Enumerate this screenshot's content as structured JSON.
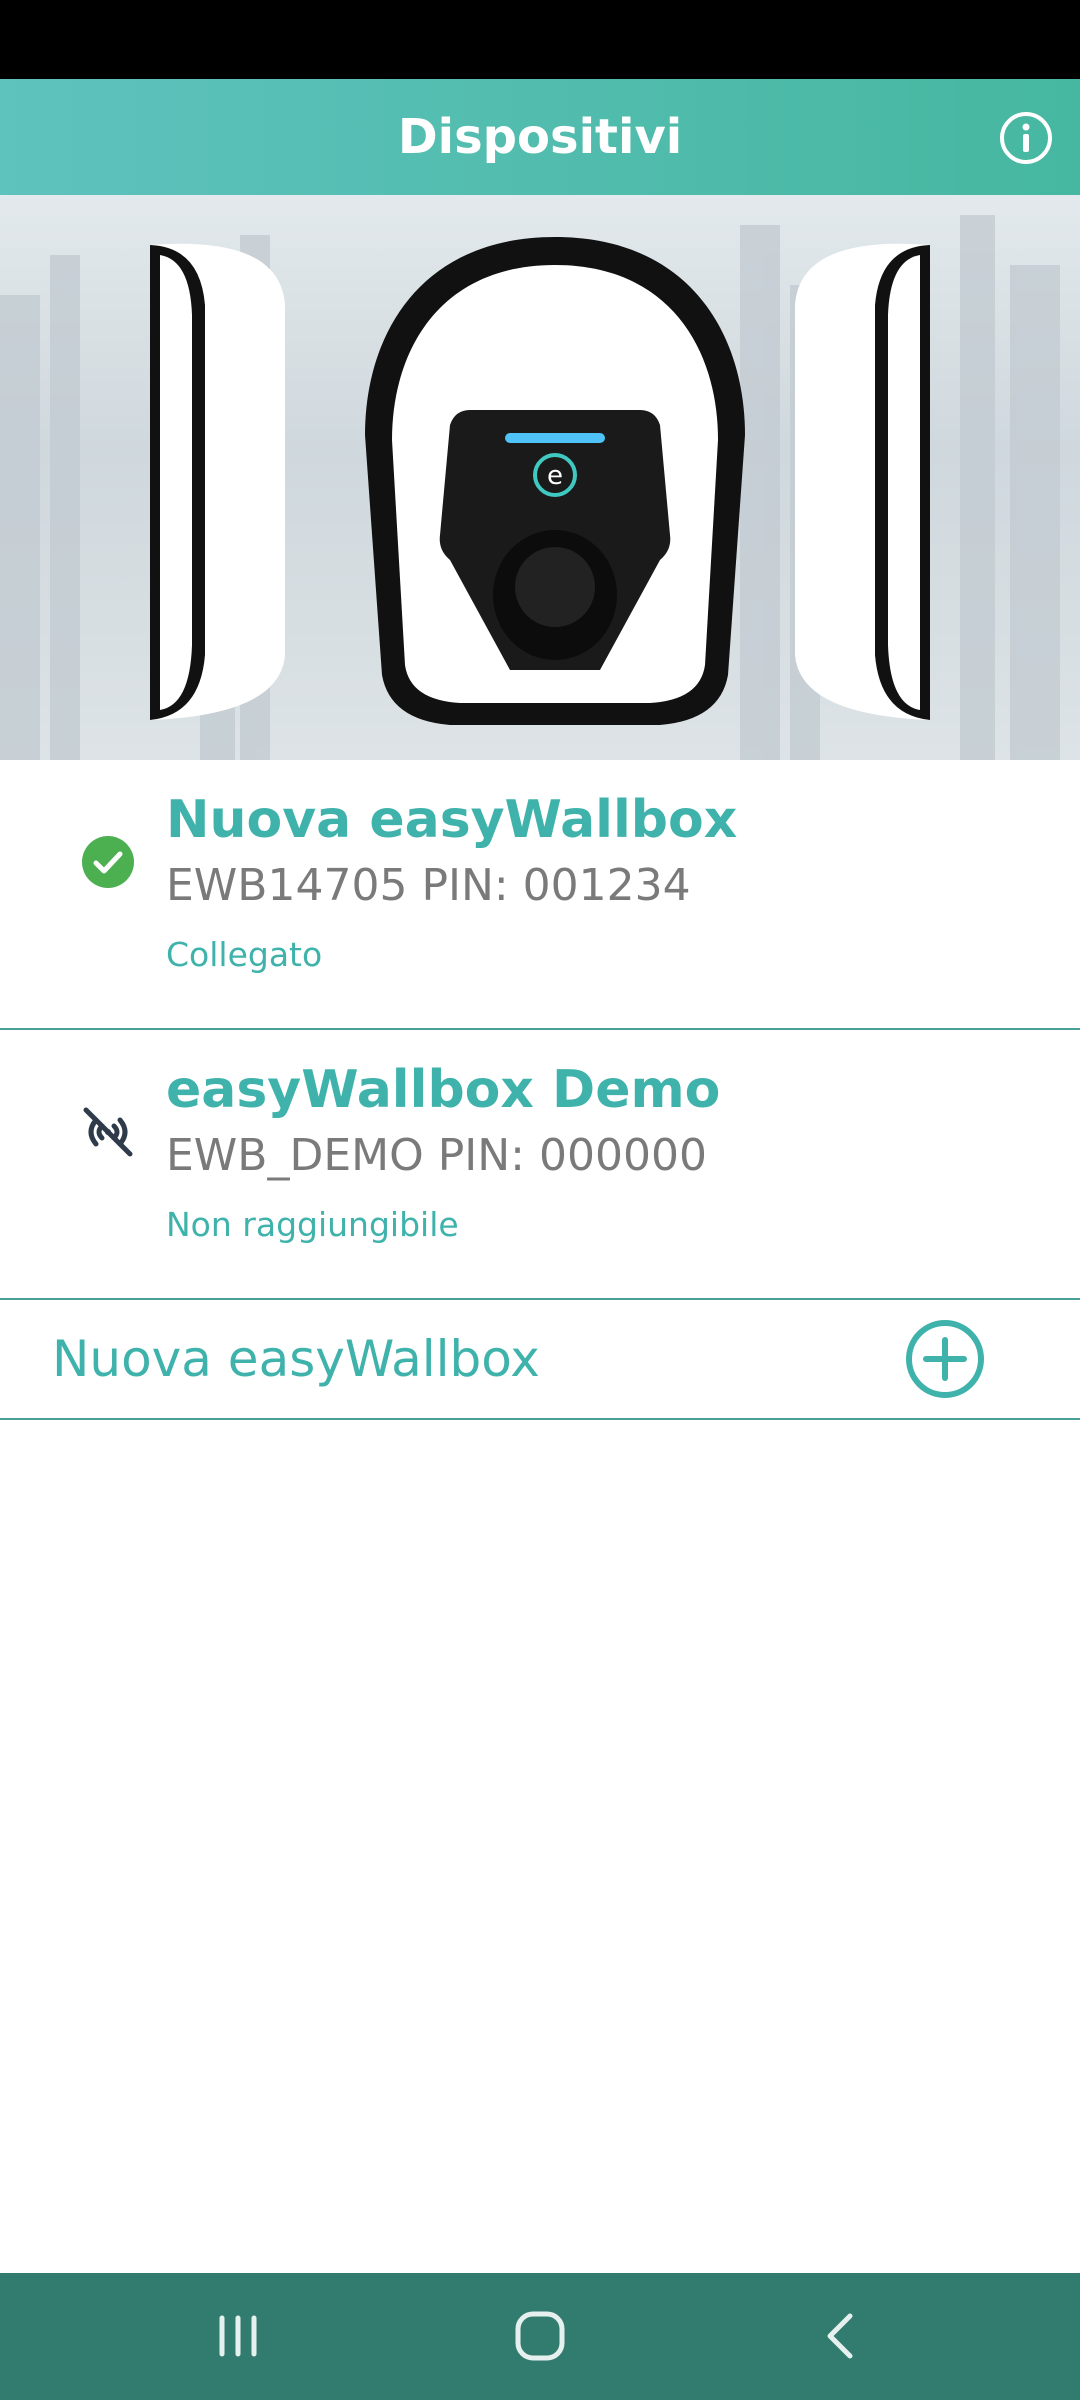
{
  "header": {
    "title": "Dispositivi",
    "info_icon": "info-icon"
  },
  "devices": [
    {
      "name": "Nuova easyWallbox",
      "ident": "EWB14705 PIN: 001234",
      "status": "Collegato",
      "icon": "check-circle-icon",
      "icon_color": "#4caf50"
    },
    {
      "name": "easyWallbox Demo",
      "ident": "EWB_DEMO PIN: 000000",
      "status": "Non raggiungibile",
      "icon": "wifi-off-icon",
      "icon_color": "#2f3b4a"
    }
  ],
  "add_device": {
    "label": "Nuova easyWallbox",
    "icon": "plus-circle-icon"
  },
  "nav": {
    "recents_icon": "recents-icon",
    "home_icon": "home-icon",
    "back_icon": "back-icon"
  },
  "colors": {
    "accent": "#3fb3ab",
    "header_start": "#5ec2bd",
    "header_end": "#46b7a0",
    "nav_bar": "#327c6f"
  }
}
